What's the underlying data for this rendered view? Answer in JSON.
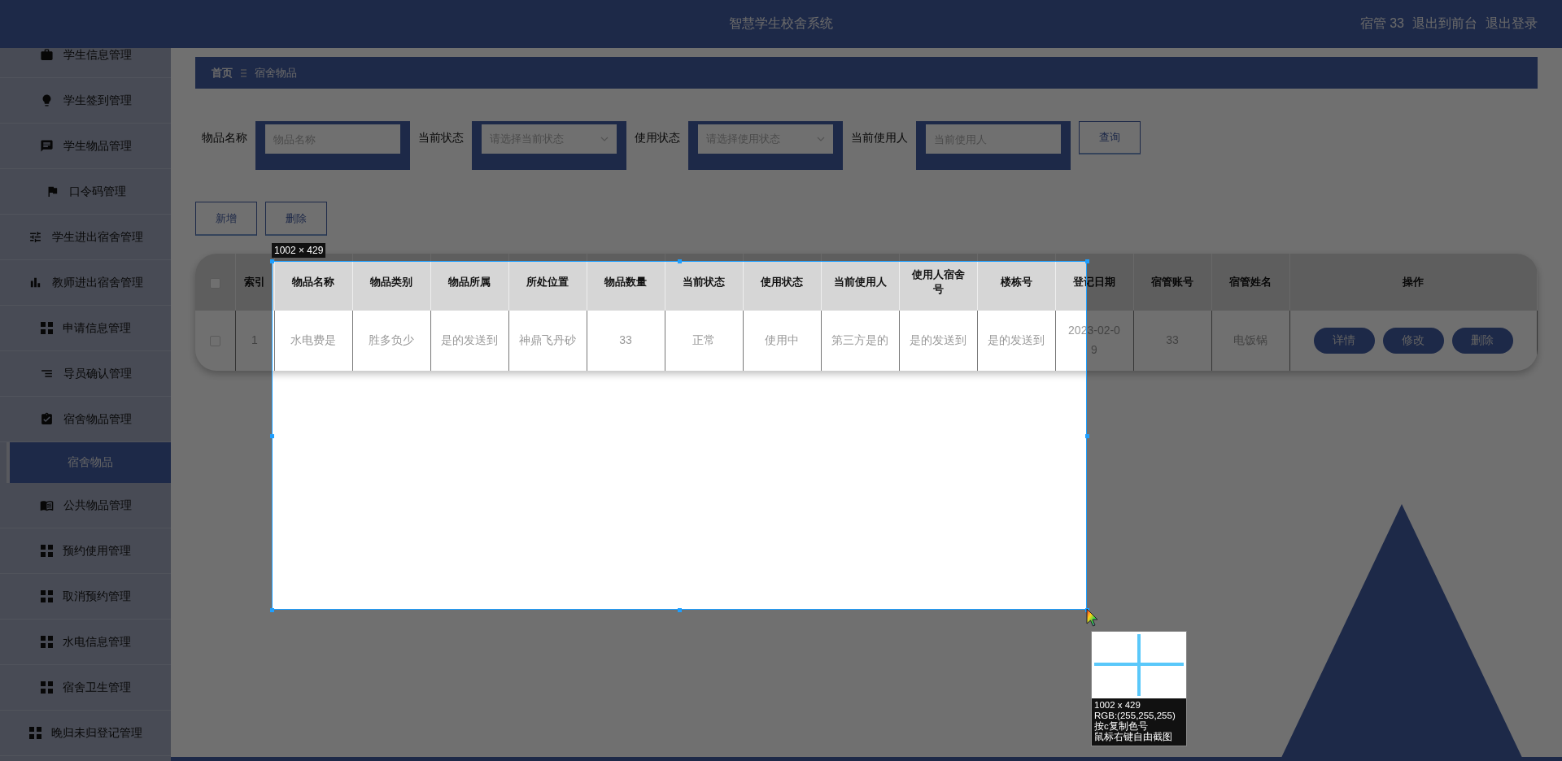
{
  "header": {
    "title": "智慧学生校舍系统",
    "user": "宿管 33",
    "links": [
      "退出到前台",
      "退出登录"
    ]
  },
  "sidebar": {
    "items": [
      {
        "label": "学生信息管理",
        "selected": false
      },
      {
        "label": "学生签到管理",
        "selected": false
      },
      {
        "label": "学生物品管理",
        "selected": false
      },
      {
        "label": "口令码管理",
        "selected": false
      },
      {
        "label": "学生进出宿舍管理",
        "selected": false
      },
      {
        "label": "教师进出宿舍管理",
        "selected": false
      },
      {
        "label": "申请信息管理",
        "selected": false
      },
      {
        "label": "导员确认管理",
        "selected": false
      },
      {
        "label": "宿舍物品管理",
        "selected": false,
        "expanded": true,
        "children": [
          {
            "label": "宿舍物品",
            "selected": true
          }
        ]
      },
      {
        "label": "公共物品管理",
        "selected": false
      },
      {
        "label": "预约使用管理",
        "selected": false
      },
      {
        "label": "取消预约管理",
        "selected": false
      },
      {
        "label": "水电信息管理",
        "selected": false
      },
      {
        "label": "宿舍卫生管理",
        "selected": false
      },
      {
        "label": "晚归未归登记管理",
        "selected": false
      }
    ]
  },
  "breadcrumb": [
    "首页",
    "宿舍物品"
  ],
  "filters": [
    {
      "label": "物品名称",
      "kind": "input",
      "placeholder": "物品名称"
    },
    {
      "label": "当前状态",
      "kind": "select",
      "placeholder": "请选择当前状态"
    },
    {
      "label": "使用状态",
      "kind": "select",
      "placeholder": "请选择使用状态"
    },
    {
      "label": "当前使用人",
      "kind": "input",
      "placeholder": "当前使用人"
    }
  ],
  "query_button": "查询",
  "actions": [
    "新增",
    "删除"
  ],
  "table": {
    "all_checked": false,
    "columns": [
      "索引",
      "物品名称",
      "物品类别",
      "物品所属",
      "所处位置",
      "物品数量",
      "当前状态",
      "使用状态",
      "当前使用人",
      "使用人宿舍号",
      "楼栋号",
      "登记日期",
      "宿管账号",
      "宿管姓名",
      "操作"
    ],
    "rows": [
      {
        "checked": false,
        "cells": [
          "1",
          "水电费是",
          "胜多负少",
          "是的发送到",
          "神鼎飞丹砂",
          "33",
          "正常",
          "使用中",
          "第三方是的",
          "是的发送到",
          "是的发送到",
          "2023-02-09",
          "33",
          "电饭锅"
        ],
        "actions": [
          "详情",
          "修改",
          "删除"
        ]
      }
    ]
  },
  "capture": {
    "size": "1002 × 429",
    "info": [
      "1002 x 429",
      "RGB:(255,255,255)",
      "按c复制色号",
      "鼠标右键自由截图"
    ]
  }
}
